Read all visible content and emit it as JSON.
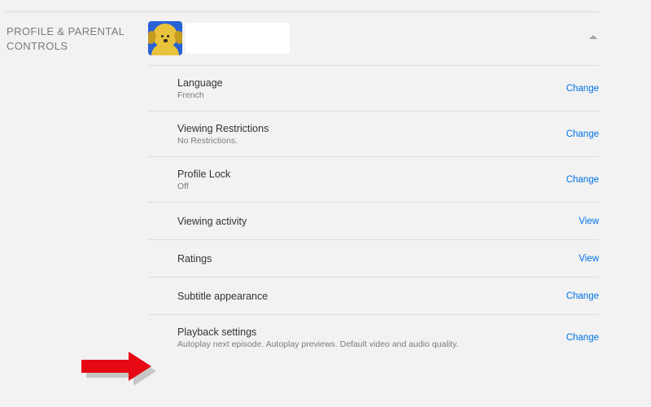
{
  "section_title": "PROFILE & PARENTAL CONTROLS",
  "profile": {
    "name": ""
  },
  "actions": {
    "change": "Change",
    "view": "View"
  },
  "rows": {
    "language": {
      "title": "Language",
      "sub": "French"
    },
    "viewing_restrictions": {
      "title": "Viewing Restrictions",
      "sub": "No Restrictions."
    },
    "profile_lock": {
      "title": "Profile Lock",
      "sub": "Off"
    },
    "viewing_activity": {
      "title": "Viewing activity"
    },
    "ratings": {
      "title": "Ratings"
    },
    "subtitle_appearance": {
      "title": "Subtitle appearance"
    },
    "playback_settings": {
      "title": "Playback settings",
      "sub": "Autoplay next episode. Autoplay previews. Default video and audio quality."
    }
  }
}
